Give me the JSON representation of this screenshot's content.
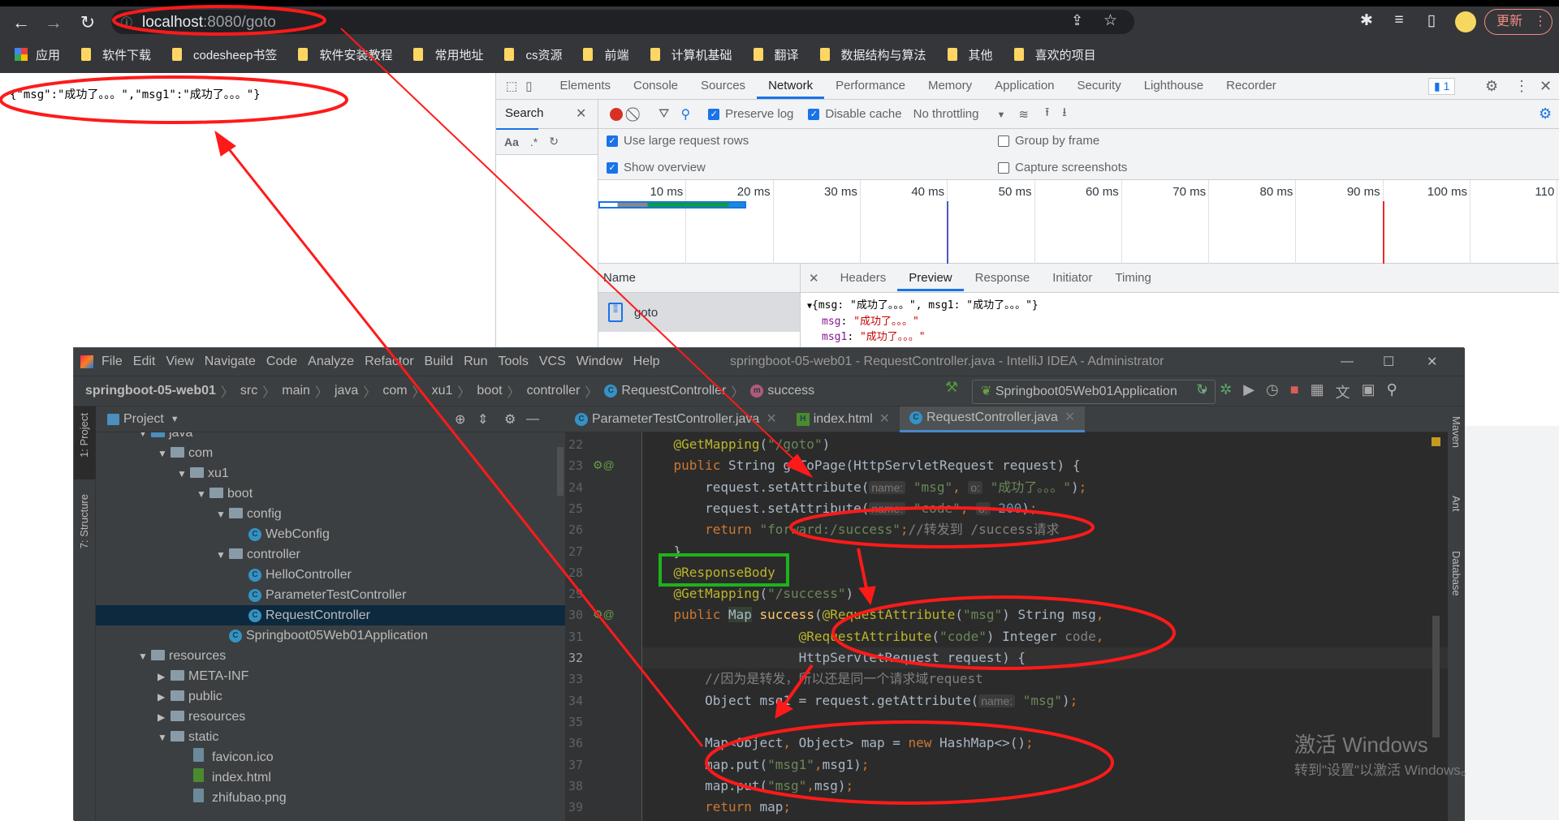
{
  "browser": {
    "url_host": "localhost",
    "url_rest": ":8080/goto",
    "update_label": "更新",
    "bookmarks": [
      "应用",
      "软件下载",
      "codesheep书签",
      "软件安装教程",
      "常用地址",
      "cs资源",
      "前端",
      "计算机基础",
      "翻译",
      "数据结构与算法",
      "其他",
      "喜欢的项目"
    ]
  },
  "page": {
    "body_text": "{\"msg\":\"成功了。。。\",\"msg1\":\"成功了。。。\"}"
  },
  "devtools": {
    "tabs": [
      "Elements",
      "Console",
      "Sources",
      "Network",
      "Performance",
      "Memory",
      "Application",
      "Security",
      "Lighthouse",
      "Recorder"
    ],
    "active_tab": "Network",
    "issues_count": "1",
    "search_label": "Search",
    "search_opts": [
      "Aa",
      ".*"
    ],
    "preserve_log": "Preserve log",
    "disable_cache": "Disable cache",
    "throttling": "No throttling",
    "settings": [
      {
        "label": "Use large request rows",
        "checked": true
      },
      {
        "label": "Show overview",
        "checked": true
      },
      {
        "label": "Group by frame",
        "checked": false
      },
      {
        "label": "Capture screenshots",
        "checked": false
      }
    ],
    "timeline_ticks": [
      "10 ms",
      "20 ms",
      "30 ms",
      "40 ms",
      "50 ms",
      "60 ms",
      "70 ms",
      "80 ms",
      "90 ms",
      "100 ms",
      "110"
    ],
    "dom_content_loaded_ms": 40,
    "load_ms": 90,
    "name_header": "Name",
    "request_name": "goto",
    "detail_tabs": [
      "Headers",
      "Preview",
      "Response",
      "Initiator",
      "Timing"
    ],
    "active_detail_tab": "Preview",
    "preview": {
      "summary": "{msg: \"成功了。。。\", msg1: \"成功了。。。\"}",
      "rows": [
        {
          "key": "msg",
          "value": "\"成功了。。。\""
        },
        {
          "key": "msg1",
          "value": "\"成功了。。。\""
        }
      ]
    }
  },
  "ide": {
    "menu": [
      "File",
      "Edit",
      "View",
      "Navigate",
      "Code",
      "Analyze",
      "Refactor",
      "Build",
      "Run",
      "Tools",
      "VCS",
      "Window",
      "Help"
    ],
    "title": "springboot-05-web01 - RequestController.java - IntelliJ IDEA - Administrator",
    "breadcrumb": [
      "springboot-05-web01",
      "src",
      "main",
      "java",
      "com",
      "xu1",
      "boot",
      "controller",
      "RequestController",
      "success"
    ],
    "run_config": "Springboot05Web01Application",
    "project_label": "Project",
    "left_tools": [
      "1: Project",
      "7: Structure"
    ],
    "right_tools": [
      "Maven",
      "Ant",
      "Database"
    ],
    "editor_tabs": [
      "ParameterTestController.java",
      "index.html",
      "RequestController.java"
    ],
    "active_editor_tab": "RequestController.java",
    "tree": [
      {
        "d": 0,
        "t": "v",
        "i": "folder-blue",
        "label": "java"
      },
      {
        "d": 1,
        "t": "v",
        "i": "package",
        "label": "com"
      },
      {
        "d": 2,
        "t": "v",
        "i": "package",
        "label": "xu1"
      },
      {
        "d": 3,
        "t": "v",
        "i": "package",
        "label": "boot"
      },
      {
        "d": 4,
        "t": "v",
        "i": "package",
        "label": "config"
      },
      {
        "d": 5,
        "t": "",
        "i": "class",
        "label": "WebConfig"
      },
      {
        "d": 4,
        "t": "v",
        "i": "package",
        "label": "controller"
      },
      {
        "d": 5,
        "t": "",
        "i": "class",
        "label": "HelloController"
      },
      {
        "d": 5,
        "t": "",
        "i": "class",
        "label": "ParameterTestController"
      },
      {
        "d": 5,
        "t": "",
        "i": "class",
        "label": "RequestController",
        "selected": true
      },
      {
        "d": 4,
        "t": "",
        "i": "spring-class",
        "label": "Springboot05Web01Application"
      },
      {
        "d": 0,
        "t": "v",
        "i": "folder-res",
        "label": "resources"
      },
      {
        "d": 1,
        "t": ">",
        "i": "folder",
        "label": "META-INF"
      },
      {
        "d": 1,
        "t": ">",
        "i": "folder",
        "label": "public"
      },
      {
        "d": 1,
        "t": ">",
        "i": "folder",
        "label": "resources"
      },
      {
        "d": 1,
        "t": "v",
        "i": "folder",
        "label": "static"
      },
      {
        "d": 2,
        "t": "",
        "i": "image-file",
        "label": "favicon.ico"
      },
      {
        "d": 2,
        "t": "",
        "i": "html-file",
        "label": "index.html"
      },
      {
        "d": 2,
        "t": "",
        "i": "image-file",
        "label": "zhifubao.png"
      }
    ],
    "code": [
      {
        "n": "22",
        "tokens": [
          [
            "",
            "    "
          ],
          [
            "a",
            "@GetMapping"
          ],
          [
            "",
            "("
          ],
          [
            "s",
            "\"/goto\""
          ],
          [
            "",
            ")"
          ]
        ]
      },
      {
        "n": "23",
        "tokens": [
          [
            "",
            "    "
          ],
          [
            "k",
            "public "
          ],
          [
            "",
            "String goToPage(HttpServletRequest request) {"
          ]
        ]
      },
      {
        "n": "24",
        "tokens": [
          [
            "",
            "        request.setAttribute("
          ],
          [
            "h",
            "name:"
          ],
          [
            "s",
            " \"msg\""
          ],
          [
            "k",
            ", "
          ],
          [
            "h",
            "o:"
          ],
          [
            "s",
            " \"成功了。。。\""
          ],
          [
            "",
            "​)"
          ],
          [
            "k",
            ";"
          ]
        ]
      },
      {
        "n": "25",
        "tokens": [
          [
            "",
            "        request.setAttribute("
          ],
          [
            "h",
            "name:"
          ],
          [
            "s",
            " \"code\""
          ],
          [
            "k",
            ", "
          ],
          [
            "h",
            "o:"
          ],
          [
            "n",
            " 200"
          ],
          [
            "",
            ")"
          ],
          [
            "k",
            ";"
          ]
        ]
      },
      {
        "n": "26",
        "tokens": [
          [
            "",
            "        "
          ],
          [
            "k",
            "return "
          ],
          [
            "s",
            "\"forward:/success\""
          ],
          [
            "k",
            ";"
          ],
          [
            "c",
            "//转发到 /success请求"
          ]
        ]
      },
      {
        "n": "27",
        "tokens": [
          [
            "",
            "    }"
          ]
        ]
      },
      {
        "n": "28",
        "tokens": [
          [
            "",
            "    "
          ],
          [
            "a",
            "@ResponseBody"
          ]
        ]
      },
      {
        "n": "29",
        "tokens": [
          [
            "",
            "    "
          ],
          [
            "a",
            "@GetMapping"
          ],
          [
            "",
            "("
          ],
          [
            "s",
            "\"/success\""
          ],
          [
            "",
            ")"
          ]
        ]
      },
      {
        "n": "30",
        "tokens": [
          [
            "",
            "    "
          ],
          [
            "k",
            "public "
          ],
          [
            "t",
            "Map"
          ],
          [
            "",
            " "
          ],
          [
            "m",
            "success"
          ],
          [
            "",
            "("
          ],
          [
            "a",
            "@RequestAttribute"
          ],
          [
            "",
            "("
          ],
          [
            "s",
            "\"msg\""
          ],
          [
            "",
            ") String msg"
          ],
          [
            "k",
            ","
          ]
        ]
      },
      {
        "n": "31",
        "tokens": [
          [
            "",
            "                    "
          ],
          [
            "a",
            "@RequestAttribute"
          ],
          [
            "",
            "("
          ],
          [
            "s",
            "\"code\""
          ],
          [
            "",
            ") Integer "
          ],
          [
            "c",
            "code"
          ],
          [
            "k",
            ","
          ]
        ]
      },
      {
        "n": "32",
        "tokens": [
          [
            "",
            "                    HttpServletRequest request) {"
          ]
        ],
        "current": true
      },
      {
        "n": "33",
        "tokens": [
          [
            "",
            "        "
          ],
          [
            "c",
            "//因为是转发，所以还是同一个请求域request"
          ]
        ]
      },
      {
        "n": "34",
        "tokens": [
          [
            "",
            "        Object msg1 = request.getAttribute("
          ],
          [
            "h",
            "name:"
          ],
          [
            "s",
            " \"msg\""
          ],
          [
            "",
            ")"
          ],
          [
            "k",
            ";"
          ]
        ]
      },
      {
        "n": "35",
        "tokens": [
          [
            "",
            ""
          ]
        ]
      },
      {
        "n": "36",
        "tokens": [
          [
            "",
            "        Map<Object"
          ],
          [
            "k",
            ", "
          ],
          [
            "",
            "Object> map = "
          ],
          [
            "k",
            "new "
          ],
          [
            "",
            "HashMap<>()"
          ],
          [
            "k",
            ";"
          ]
        ]
      },
      {
        "n": "37",
        "tokens": [
          [
            "",
            "        map.put("
          ],
          [
            "s",
            "\"msg1\""
          ],
          [
            "k",
            ","
          ],
          [
            "",
            "msg1)"
          ],
          [
            "k",
            ";"
          ]
        ]
      },
      {
        "n": "38",
        "tokens": [
          [
            "",
            "        map.put("
          ],
          [
            "s",
            "\"msg\""
          ],
          [
            "k",
            ","
          ],
          [
            "",
            "msg)"
          ],
          [
            "k",
            ";"
          ]
        ]
      },
      {
        "n": "39",
        "tokens": [
          [
            "",
            "        "
          ],
          [
            "k",
            "return "
          ],
          [
            "",
            "map"
          ],
          [
            "k",
            ";"
          ]
        ]
      }
    ]
  },
  "watermark": {
    "line1": "激活 Windows",
    "line2": "转到\"设置\"以激活 Windows。"
  },
  "colors": {
    "annotation_red": "#ff1a1a",
    "highlight_green": "#1db31d",
    "devtools_accent": "#1a73e8"
  }
}
